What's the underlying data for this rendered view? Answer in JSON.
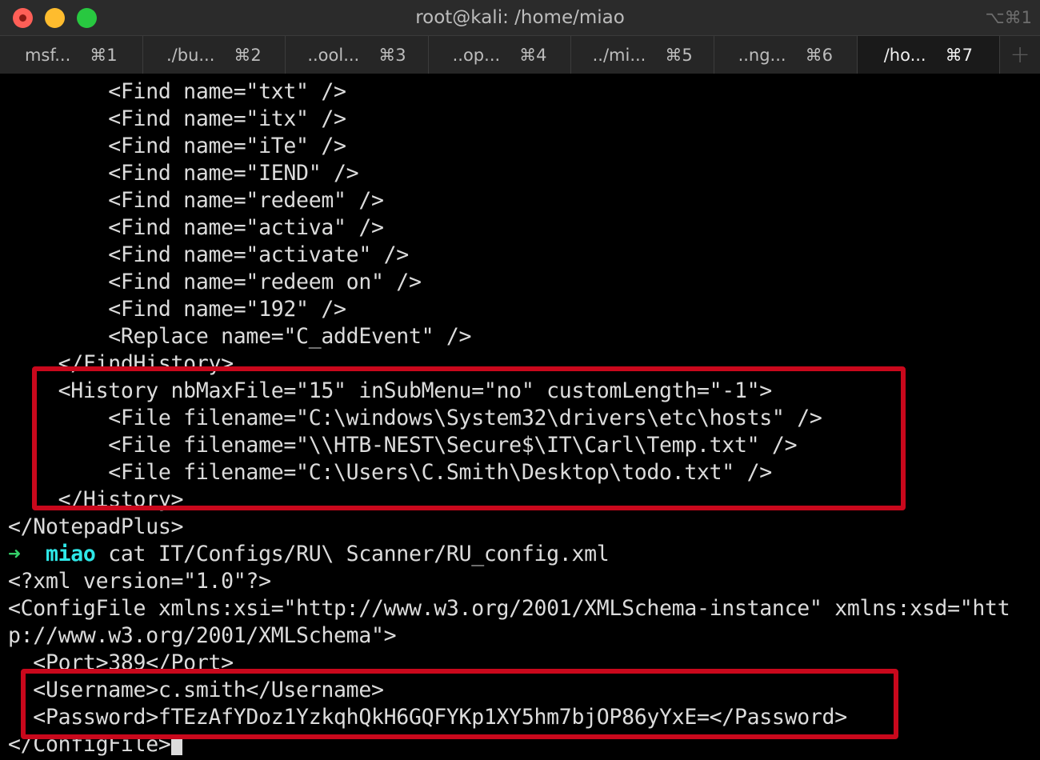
{
  "window": {
    "title": "root@kali: /home/miao",
    "shortcut": "⌥⌘1"
  },
  "tabs": [
    {
      "label": "msf...",
      "shortcut": "⌘1"
    },
    {
      "label": "./bu...",
      "shortcut": "⌘2"
    },
    {
      "label": "..ool...",
      "shortcut": "⌘3"
    },
    {
      "label": "..op...",
      "shortcut": "⌘4"
    },
    {
      "label": "../mi...",
      "shortcut": "⌘5"
    },
    {
      "label": "..ng...",
      "shortcut": "⌘6"
    },
    {
      "label": "/ho...",
      "shortcut": "⌘7"
    }
  ],
  "new_tab_symbol": "+",
  "terminal": {
    "lines": [
      "        <Find name=\"txt\" />",
      "        <Find name=\"itx\" />",
      "        <Find name=\"iTe\" />",
      "        <Find name=\"IEND\" />",
      "        <Find name=\"redeem\" />",
      "        <Find name=\"activa\" />",
      "        <Find name=\"activate\" />",
      "        <Find name=\"redeem on\" />",
      "        <Find name=\"192\" />",
      "        <Replace name=\"C_addEvent\" />",
      "    </FindHistory>",
      "    <History nbMaxFile=\"15\" inSubMenu=\"no\" customLength=\"-1\">",
      "        <File filename=\"C:\\windows\\System32\\drivers\\etc\\hosts\" />",
      "        <File filename=\"\\\\HTB-NEST\\Secure$\\IT\\Carl\\Temp.txt\" />",
      "        <File filename=\"C:\\Users\\C.Smith\\Desktop\\todo.txt\" />",
      "    </History>",
      "</NotepadPlus>",
      "",
      "<?xml version=\"1.0\"?>",
      "<ConfigFile xmlns:xsi=\"http://www.w3.org/2001/XMLSchema-instance\" xmlns:xsd=\"htt",
      "p://www.w3.org/2001/XMLSchema\">",
      "  <Port>389</Port>",
      "  <Username>c.smith</Username>",
      "  <Password>fTEzAfYDoz1YzkqhQkH6GQFYKp1XY5hm7bjOP86yYxE=</Password>",
      "</ConfigFile>"
    ],
    "prompt": {
      "arrow": "➜",
      "dir": "miao",
      "command": "cat IT/Configs/RU\\ Scanner/RU_config.xml"
    }
  },
  "colors": {
    "highlight_box": "#c9081c",
    "prompt_arrow": "#35d06a",
    "prompt_dir": "#2ee8e8"
  }
}
